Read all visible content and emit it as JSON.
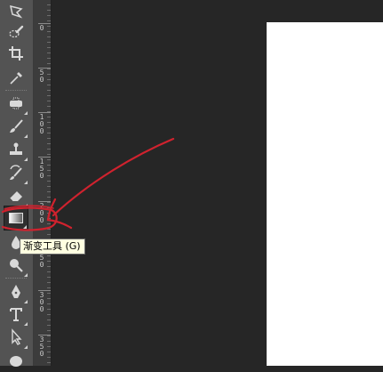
{
  "tools": [
    {
      "icon": "lasso-icon",
      "selected": false
    },
    {
      "icon": "quick-selection-icon",
      "selected": false
    },
    {
      "icon": "crop-icon",
      "selected": false
    },
    {
      "icon": "eyedropper-icon",
      "selected": false
    },
    {
      "icon": "spot-healing-icon",
      "selected": false
    },
    {
      "icon": "brush-icon",
      "selected": false
    },
    {
      "icon": "clone-stamp-icon",
      "selected": false
    },
    {
      "icon": "history-brush-icon",
      "selected": false
    },
    {
      "icon": "eraser-icon",
      "selected": false
    },
    {
      "icon": "gradient-icon",
      "selected": true
    },
    {
      "icon": "blur-icon",
      "selected": false
    },
    {
      "icon": "dodge-icon",
      "selected": false
    },
    {
      "icon": "pen-icon",
      "selected": false
    },
    {
      "icon": "type-icon",
      "selected": false
    },
    {
      "icon": "path-selection-icon",
      "selected": false
    },
    {
      "icon": "ellipse-icon",
      "selected": false
    }
  ],
  "tooltip": {
    "text": "渐变工具 (G)"
  },
  "ruler": {
    "labels": [
      "0",
      "5\n0",
      "1\n0\n0",
      "1\n5\n0",
      "2\n0\n0",
      "2\n5\n0",
      "3\n0\n0",
      "3\n5\n0"
    ]
  },
  "colors": {
    "toolbar_bg": "#535353",
    "workspace_bg": "#262626",
    "ruler_bg": "#3c3c3c",
    "document_bg": "#ffffff",
    "tooltip_bg": "#ffffe1",
    "annotation": "#d0222e"
  }
}
